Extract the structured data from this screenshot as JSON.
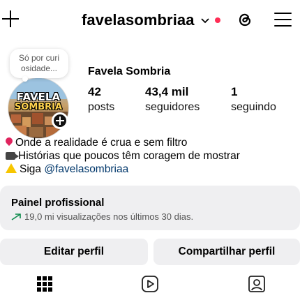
{
  "header": {
    "username": "favelasombriaa",
    "icons": [
      "plus-icon",
      "chevron-down-icon",
      "notification-dot",
      "threads-icon",
      "menu-icon"
    ],
    "dot_color": "#ff2d55"
  },
  "note": {
    "text_line1": "Só por curi",
    "text_line2": "osidade..."
  },
  "avatar": {
    "title_line1": "FAVELA",
    "title_line2": "SOMBRIA"
  },
  "profile": {
    "name": "Favela Sombria",
    "stats": [
      {
        "value": "42",
        "label": "posts"
      },
      {
        "value": "43,4 mil",
        "label": "seguidores"
      },
      {
        "value": "1",
        "label": "seguindo"
      }
    ]
  },
  "bio": {
    "line1": "Onde a realidade é crua e sem filtro",
    "line2": "Histórias que poucos têm coragem de mostrar",
    "line3_prefix": "Siga ",
    "line3_mention": "@favelasombriaa",
    "mention_color": "#00376b"
  },
  "panel": {
    "title": "Painel profissional",
    "subtitle": "19,0 mi visualizações nos últimos 30 dias."
  },
  "buttons": {
    "edit": "Editar perfil",
    "share": "Compartilhar perfil"
  },
  "tabs": [
    "grid-icon",
    "reels-icon",
    "tagged-icon"
  ]
}
